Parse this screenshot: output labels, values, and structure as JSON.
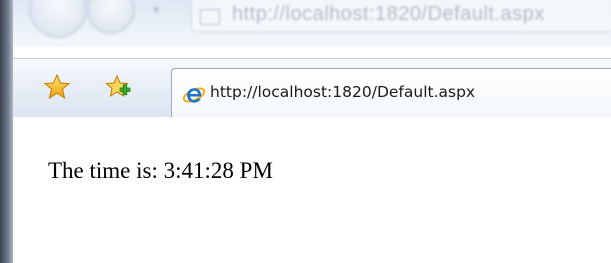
{
  "browser": {
    "top_address_text": "http://localhost:1820/Default.aspx",
    "dropdown_glyph": "▾",
    "nav_icons": [
      "back-button-icon",
      "forward-button-icon"
    ],
    "favorites_icons": [
      "favorites-star-icon",
      "add-favorite-icon"
    ],
    "tab": {
      "icon": "internet-explorer-icon",
      "title": "http://localhost:1820/Default.aspx"
    }
  },
  "page": {
    "time_text": "The time is: 3:41:28 PM"
  },
  "colors": {
    "toolbar_top": "#f7f9fc",
    "toolbar_bottom": "#dbe4ef",
    "star_gold": "#f6b91a",
    "ie_blue": "#1f72c8"
  }
}
